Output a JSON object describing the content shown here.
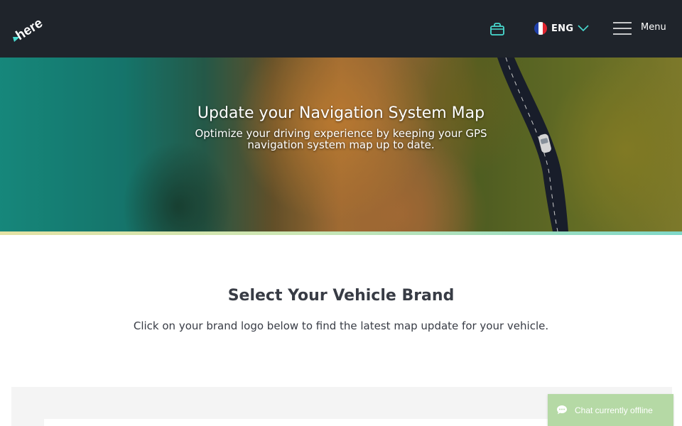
{
  "header": {
    "logo_text": "here",
    "cart_icon": "shopping-bag-icon",
    "language": {
      "label": "ENG",
      "flag": "france-flag-icon"
    },
    "menu_label": "Menu"
  },
  "hero": {
    "title": "Update your Navigation System Map",
    "subtitle": "Optimize your driving experience by keeping your GPS navigation system map up to date."
  },
  "section": {
    "title": "Select Your Vehicle Brand",
    "subtitle": "Click on your brand logo below to find the latest map update for your vehicle."
  },
  "chat": {
    "label": "Chat currently offline",
    "icon": "chat-bubble-icon"
  },
  "colors": {
    "header_bg": "#1f242b",
    "accent_teal": "#48dad0",
    "chat_bg": "#b5d9a5",
    "text_dark": "#383c45"
  }
}
